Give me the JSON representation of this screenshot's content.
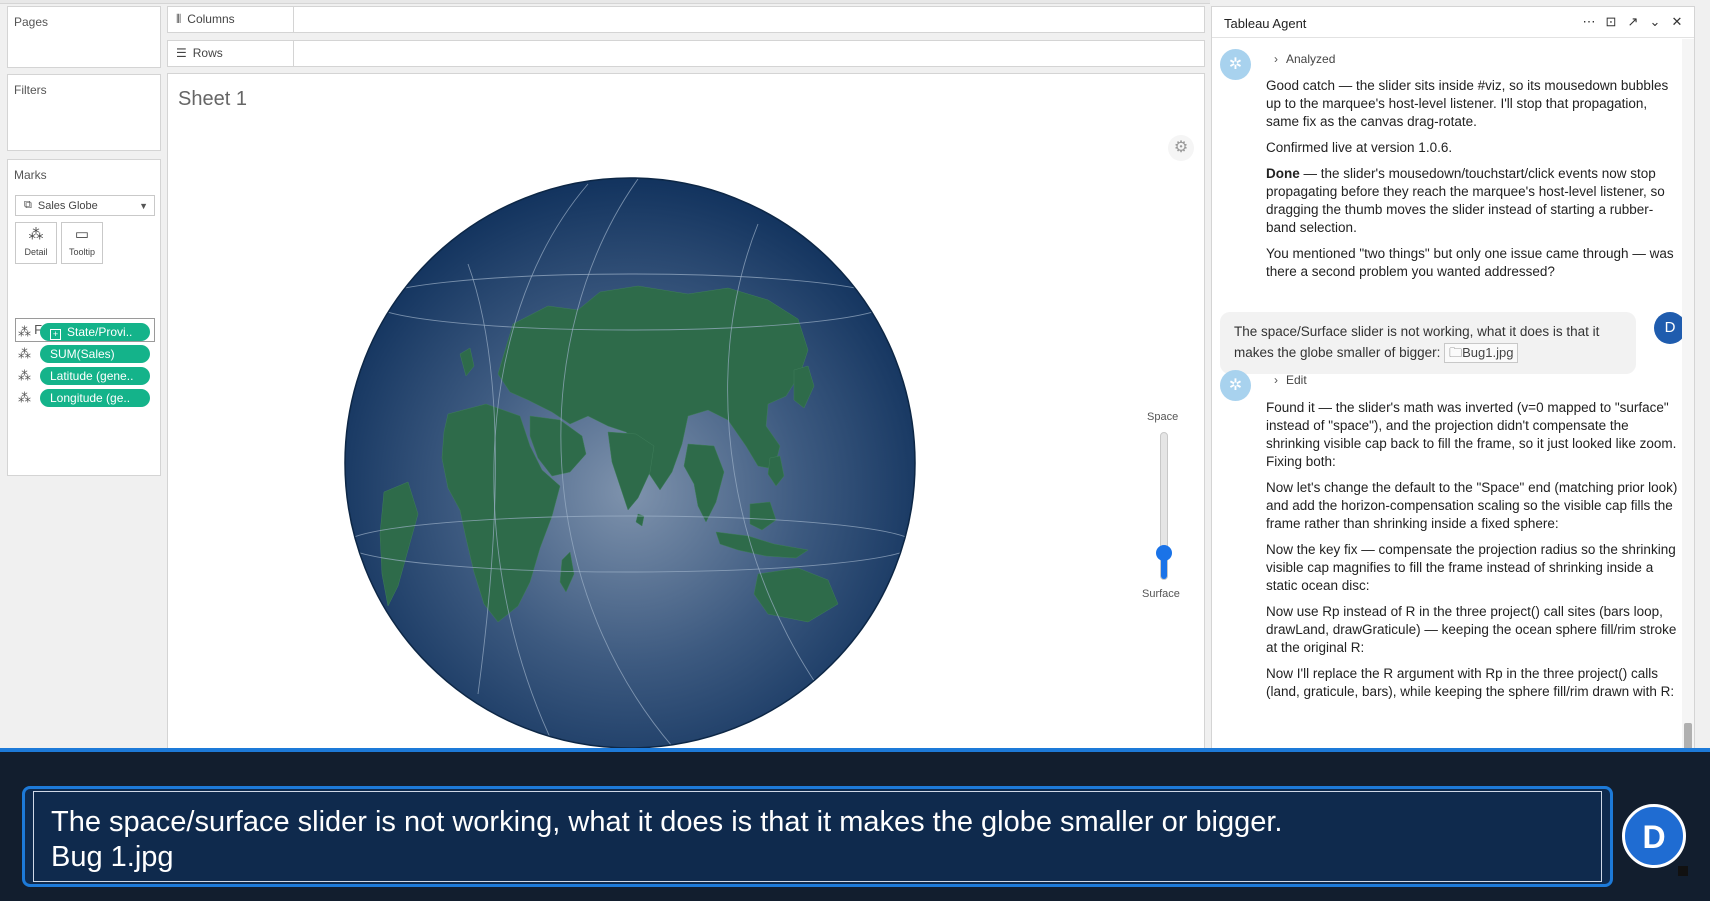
{
  "left_panel": {
    "pages_label": "Pages",
    "filters_label": "Filters",
    "marks_label": "Marks",
    "mark_type": "Sales Globe",
    "mark_buttons": [
      {
        "label": "Detail",
        "icon": "detail-icon"
      },
      {
        "label": "Tooltip",
        "icon": "tooltip-icon"
      }
    ],
    "format_extension": "Format Extension",
    "fields": [
      {
        "label": "State/Provi..",
        "has_plus": true
      },
      {
        "label": "SUM(Sales)"
      },
      {
        "label": "Latitude (gene.."
      },
      {
        "label": "Longitude (ge.."
      }
    ]
  },
  "shelves": {
    "columns": "Columns",
    "rows": "Rows"
  },
  "viz": {
    "sheet_title": "Sheet 1",
    "slider_top_label": "Space",
    "slider_bottom_label": "Surface",
    "slider_level": 0.18,
    "colors": {
      "ocean_center": "#7f93ad",
      "ocean_edge": "#12335e",
      "land": "#2e6b4a",
      "graticule": "#9db1c8",
      "accent": "#1a73e8"
    }
  },
  "agent": {
    "title": "Tableau Agent",
    "msg1_status": "Analyzed",
    "msg1_p1": "Good catch — the slider sits inside #viz, so its mousedown bubbles up to the marquee's host-level listener. I'll stop that propagation, same fix as the canvas drag-rotate.",
    "msg1_p2": "Confirmed live at version 1.0.6.",
    "msg1_p3_bold": "Done",
    "msg1_p3": " — the slider's mousedown/touchstart/click events now stop propagating before they reach the marquee's host-level listener, so dragging the thumb moves the slider instead of starting a rubber-band selection.",
    "msg1_p4": "You mentioned \"two things\" but only one issue came through — was there a second problem you wanted addressed?",
    "user_msg": "The space/Surface slider is not working, what it does is that it makes the globe smaller of bigger:",
    "user_attachment": "Bug1.jpg",
    "user_initial": "D",
    "msg2_status": "Edit",
    "msg2_p1": "Found it — the slider's math was inverted (v=0 mapped to \"surface\" instead of \"space\"), and the projection didn't compensate the shrinking visible cap back to fill the frame, so it just looked like zoom. Fixing both:",
    "msg2_p2": "Now let's change the default to the \"Space\" end (matching prior look) and add the horizon-compensation scaling so the visible cap fills the frame rather than shrinking inside a fixed sphere:",
    "msg2_p3": "Now the key fix — compensate the projection radius so the shrinking visible cap magnifies to fill the frame instead of shrinking inside a static ocean disc:",
    "msg2_p4": "Now use Rp instead of R in the three project() call sites (bars loop, drawLand, drawGraticule) — keeping the ocean sphere fill/rim stroke at the original R:",
    "msg2_p5": "Now I'll replace the R argument with Rp in the three project() calls (land, graticule, bars), while keeping the sphere fill/rim drawn with R:"
  },
  "dictation": {
    "line1": "The space/surface slider is not working, what it does is that it makes the globe smaller or bigger.",
    "line2": "Bug 1.jpg",
    "initial": "D"
  }
}
